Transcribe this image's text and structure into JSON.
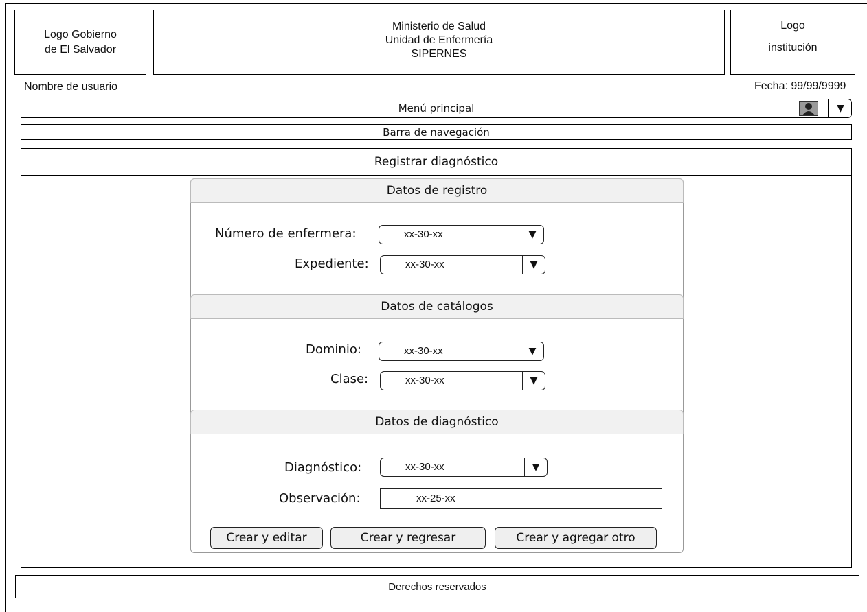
{
  "header": {
    "logo_left": "Logo Gobierno\nde El Salvador",
    "center_line1": "Ministerio de Salud",
    "center_line2": "Unidad de Enfermería",
    "center_line3": "SIPERNES",
    "logo_right_line1": "Logo",
    "logo_right_line2": "institución"
  },
  "user_name": "Nombre de usuario",
  "date": "Fecha: 99/99/9999",
  "menu": {
    "label": "Menú principal",
    "dropdown_icon": "▼",
    "avatar_icon": "user-avatar-icon"
  },
  "navbar": {
    "label": "Barra de navegación"
  },
  "main": {
    "title": "Registrar  diagnóstico",
    "sections": {
      "registro": {
        "title": "Datos de registro",
        "nurse_label": "Número  de enfermera:",
        "nurse_value": "xx-30-xx",
        "record_label": "Expediente:",
        "record_value": "xx-30-xx"
      },
      "catalogos": {
        "title": "Datos de catálogos",
        "domain_label": "Dominio:",
        "domain_value": "xx-30-xx",
        "class_label": "Clase:",
        "class_value": "xx-30-xx"
      },
      "diagnostico": {
        "title": "Datos de diagnóstico",
        "diagnosis_label": "Diagnóstico:",
        "diagnosis_value": "xx-30-xx",
        "observation_label": "Observación:",
        "observation_value": "xx-25-xx"
      }
    },
    "buttons": {
      "create_edit": "Crear y editar",
      "create_back": "Crear y regresar",
      "create_add": "Crear y agregar otro"
    }
  },
  "footer": {
    "label": "Derechos reservados"
  }
}
